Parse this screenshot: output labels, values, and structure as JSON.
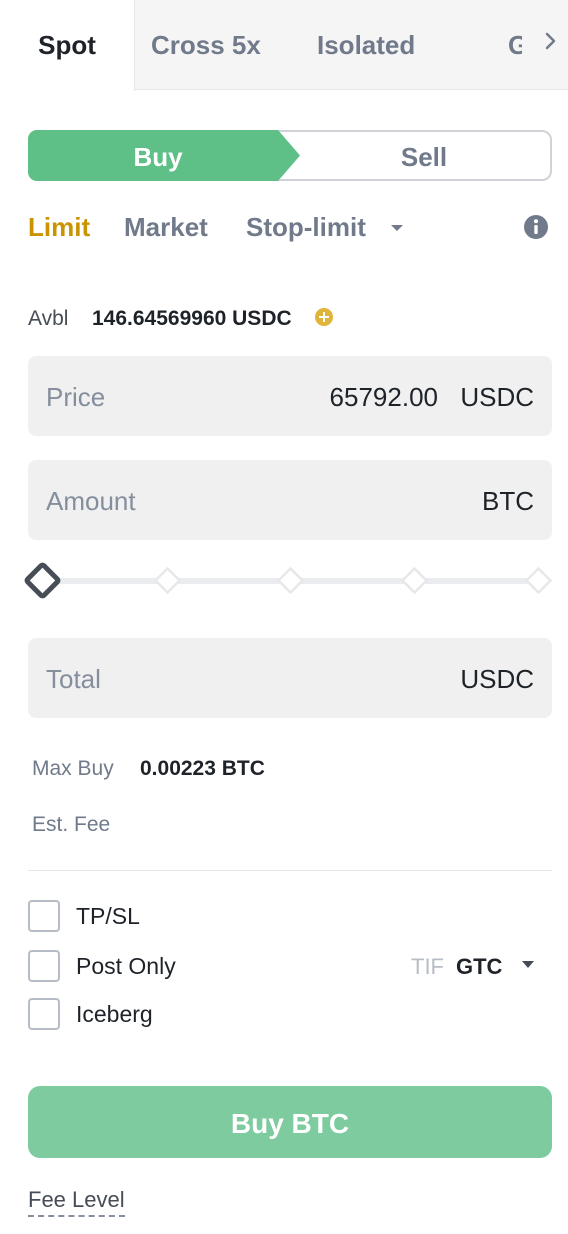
{
  "tabs": {
    "spot": "Spot",
    "cross": "Cross 5x",
    "isolated": "Isolated",
    "grid": "Grid"
  },
  "side": {
    "buy": "Buy",
    "sell": "Sell",
    "active": "Buy"
  },
  "order_types": {
    "limit": "Limit",
    "market": "Market",
    "stop_limit": "Stop-limit",
    "active": "Limit"
  },
  "avbl": {
    "label": "Avbl",
    "value": "146.64569960 USDC"
  },
  "price": {
    "label": "Price",
    "value": "65792.00",
    "unit": "USDC"
  },
  "amount": {
    "label": "Amount",
    "value": "",
    "unit": "BTC"
  },
  "slider": {
    "percent": 0,
    "steps": [
      0,
      25,
      50,
      75,
      100
    ]
  },
  "total": {
    "label": "Total",
    "value": "",
    "unit": "USDC"
  },
  "max_buy": {
    "label": "Max Buy",
    "value": "0.00223 BTC"
  },
  "est_fee": {
    "label": "Est. Fee"
  },
  "options": {
    "tpsl": {
      "label": "TP/SL",
      "checked": false
    },
    "post_only": {
      "label": "Post Only",
      "checked": false
    },
    "iceberg": {
      "label": "Iceberg",
      "checked": false
    }
  },
  "tif": {
    "label": "TIF",
    "value": "GTC"
  },
  "submit": {
    "label": "Buy BTC"
  },
  "fee_level": "Fee Level",
  "colors": {
    "buy_green": "#5ebf87",
    "buy_button": "#7dcb9e",
    "limit_active": "#c99400",
    "field_bg": "#f0f0f0"
  }
}
